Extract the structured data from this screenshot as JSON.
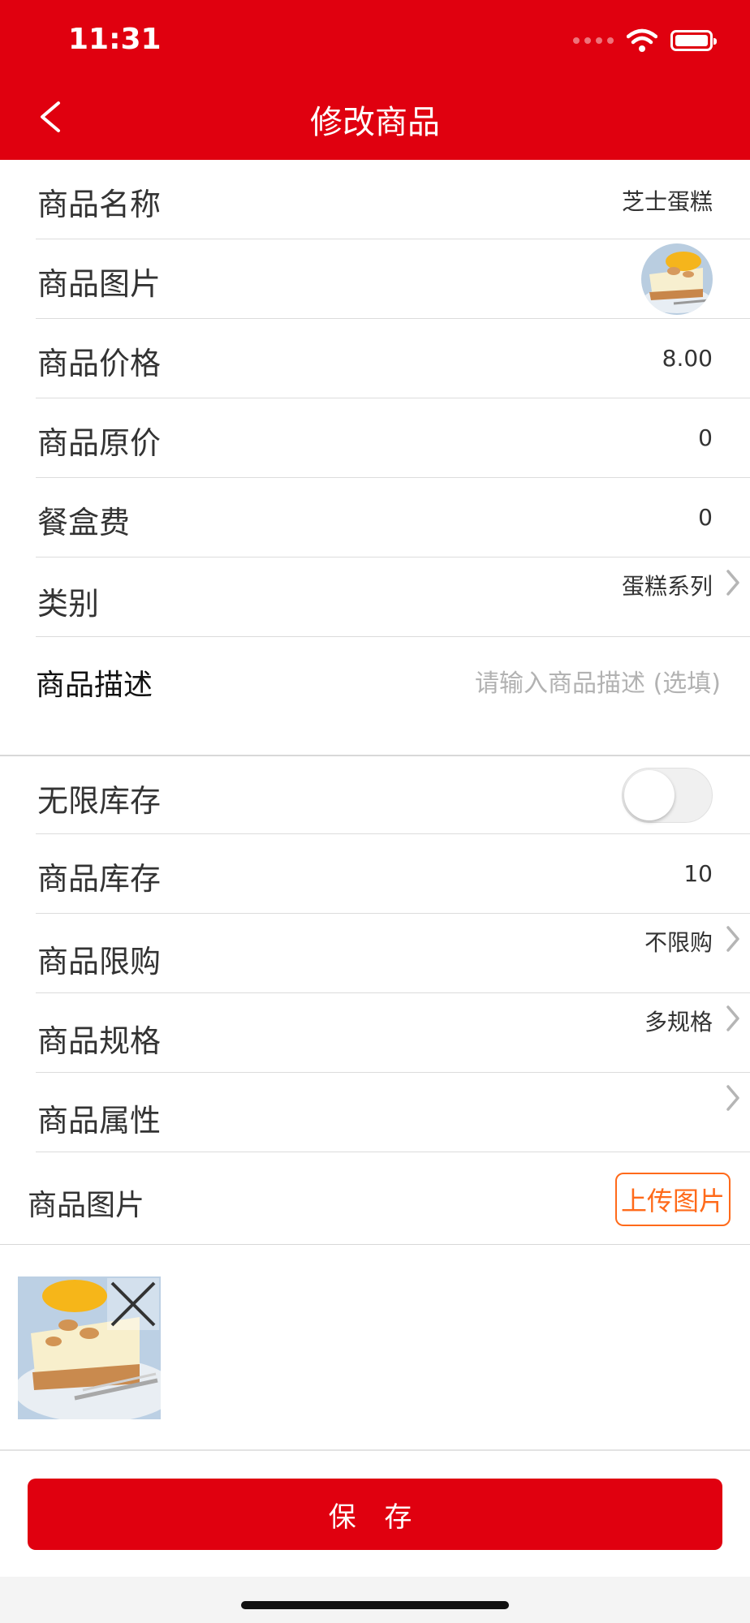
{
  "status_bar": {
    "time": "11:31"
  },
  "header": {
    "title": "修改商品",
    "back_icon": "chevron-left-icon"
  },
  "colors": {
    "brand": "#e0000f",
    "accent": "#ff6a1a"
  },
  "form": {
    "name": {
      "label": "商品名称",
      "value": "芝士蛋糕"
    },
    "image": {
      "label": "商品图片"
    },
    "price": {
      "label": "商品价格",
      "value": "8.00"
    },
    "original_price": {
      "label": "商品原价",
      "value": "0"
    },
    "box_fee": {
      "label": "餐盒费",
      "value": "0"
    },
    "category": {
      "label": "类别",
      "value": "蛋糕系列"
    },
    "description": {
      "label": "商品描述",
      "placeholder": "请输入商品描述 (选填)"
    },
    "unlimited_stock": {
      "label": "无限库存",
      "on": false
    },
    "stock": {
      "label": "商品库存",
      "value": "10"
    },
    "purchase_limit": {
      "label": "商品限购",
      "value": "不限购"
    },
    "spec": {
      "label": "商品规格",
      "value": "多规格"
    },
    "attributes": {
      "label": "商品属性",
      "value": ""
    },
    "gallery": {
      "label": "商品图片",
      "upload_label": "上传图片"
    }
  },
  "footer": {
    "save_label": "保 存"
  }
}
